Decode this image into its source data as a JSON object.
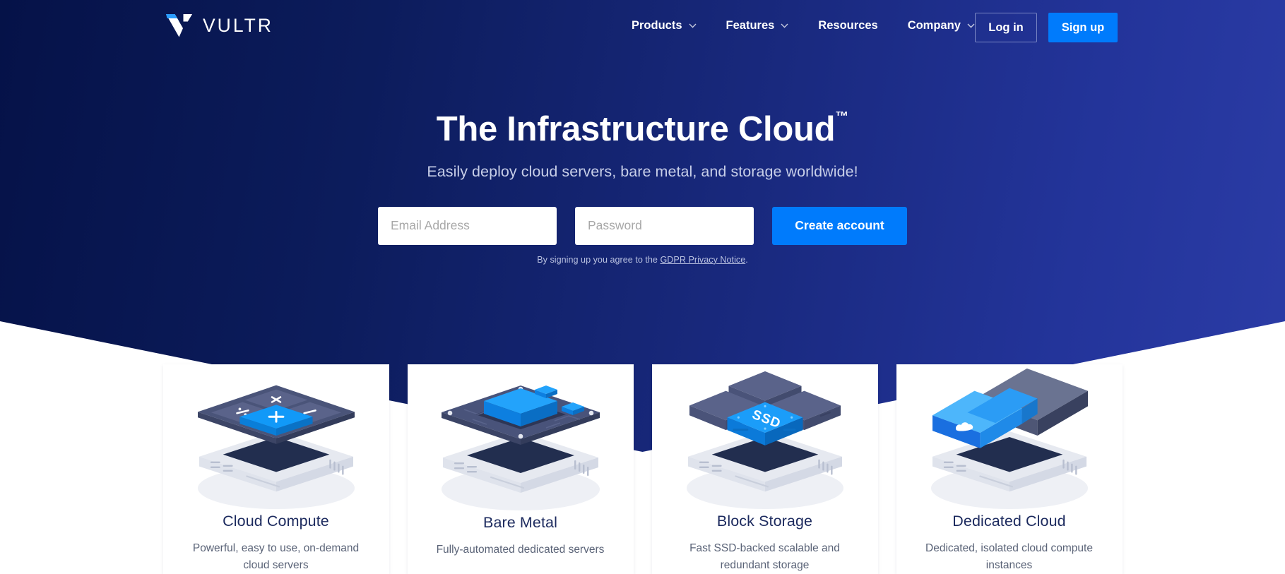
{
  "brand": {
    "logo_text": "VULTR",
    "logo_icon": "vultr-v-logo",
    "accent_blue": "#007bfc",
    "logo_blue": "#2b9dfc",
    "bg_navy_dark": "#051248",
    "bg_navy_light": "#2b3ca6"
  },
  "nav": {
    "items": [
      {
        "label": "Products",
        "has_caret": true,
        "icon": "chevron-down-icon"
      },
      {
        "label": "Features",
        "has_caret": true,
        "icon": "chevron-down-icon"
      },
      {
        "label": "Resources",
        "has_caret": false,
        "icon": ""
      },
      {
        "label": "Company",
        "has_caret": true,
        "icon": "chevron-down-icon"
      }
    ],
    "login_label": "Log in",
    "signup_label": "Sign up"
  },
  "hero": {
    "title": "The Infrastructure Cloud",
    "title_trademark": "™",
    "subtitle": "Easily deploy cloud servers, bare metal, and storage worldwide!",
    "form": {
      "email_placeholder": "Email Address",
      "email_value": "",
      "password_placeholder": "Password",
      "password_value": "",
      "submit_label": "Create account"
    },
    "legal_prefix": "By signing up you agree to the ",
    "legal_link": "GDPR Privacy Notice",
    "legal_suffix": "."
  },
  "cards": [
    {
      "title": "Cloud Compute",
      "description": "Powerful, easy to use, on-demand cloud servers",
      "art": "cloud-compute-illustration"
    },
    {
      "title": "Bare Metal",
      "description": "Fully-automated dedicated servers",
      "art": "bare-metal-illustration"
    },
    {
      "title": "Block Storage",
      "description": "Fast SSD-backed scalable and redundant storage",
      "art": "block-storage-illustration"
    },
    {
      "title": "Dedicated Cloud",
      "description": "Dedicated, isolated cloud compute instances",
      "art": "dedicated-cloud-illustration"
    }
  ]
}
